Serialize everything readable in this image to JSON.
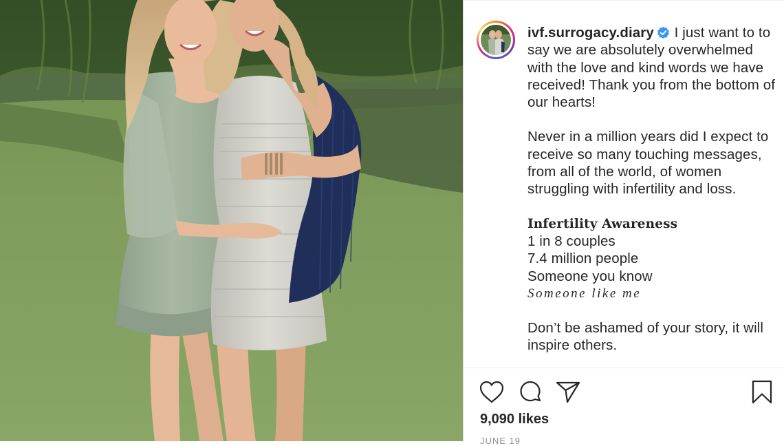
{
  "post": {
    "username": "ivf.surrogacy.diary",
    "verified": true,
    "paragraph_1": "I just want to to say we are absolutely overwhelmed with the love and kind words we have received! Thank you from the bottom of our hearts!",
    "paragraph_2": "Never in a million years did I expect to receive so many touching messages, from all of the world, of women struggling with infertility and loss.",
    "awareness": {
      "title": "Infertility Awareness",
      "line_1": "1 in 8 couples",
      "line_2": "7.4 million people",
      "line_3": "Someone you know",
      "line_4": "Someone like me"
    },
    "paragraph_3": "Don’t be ashamed of your story, it will inspire others.",
    "likes": "9,090 likes",
    "date": "JUNE 19"
  },
  "icons": {
    "like": "heart-icon",
    "comment": "comment-icon",
    "share": "paper-plane-icon",
    "save": "bookmark-icon",
    "verified": "verified-badge-icon"
  },
  "colors": {
    "text": "#262626",
    "verified": "#3897f0",
    "muted": "#8e8e8e",
    "divider": "#efefef"
  }
}
